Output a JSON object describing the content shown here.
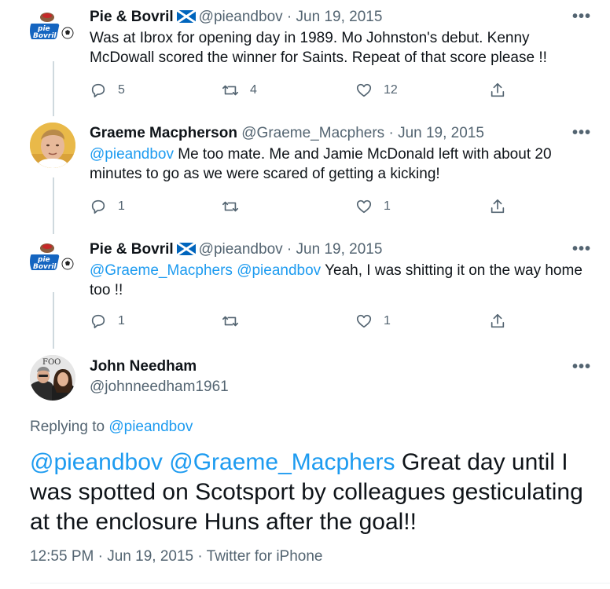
{
  "tweets": [
    {
      "name": "Pie & Bovril",
      "has_flag": true,
      "handle": "@pieandbov",
      "sep": "·",
      "date": "Jun 19, 2015",
      "text": "Was at Ibrox for opening day in 1989. Mo Johnston's debut. Kenny McDowall scored the winner for Saints. Repeat of that score please !!",
      "replies": "5",
      "retweets": "4",
      "likes": "12"
    },
    {
      "name": "Graeme Macpherson",
      "handle": "@Graeme_Macphers",
      "sep": "·",
      "date": "Jun 19, 2015",
      "mention": "@pieandbov",
      "text": " Me too mate. Me and Jamie McDonald left with about 20 minutes to go as we were scared of getting a kicking!",
      "replies": "1",
      "retweets": "",
      "likes": "1"
    },
    {
      "name": "Pie & Bovril",
      "has_flag": true,
      "handle": "@pieandbov",
      "sep": "·",
      "date": "Jun 19, 2015",
      "mention1": "@Graeme_Macphers",
      "mention2": "@pieandbov",
      "text": " Yeah, I was shitting it on the way home too !!",
      "replies": "1",
      "retweets": "",
      "likes": "1"
    }
  ],
  "main_tweet": {
    "name": "John Needham",
    "handle": "@johnneedham1961",
    "replying_prefix": "Replying to ",
    "replying_to": "@pieandbov",
    "mention1": "@pieandbov",
    "mention2": "@Graeme_Macphers",
    "text": " Great day until I was spotted on Scotsport by colleagues gesticulating at the enclosure Huns after the goal!!",
    "time": "12:55 PM",
    "sep": "·",
    "date": "Jun 19, 2015",
    "source": "Twitter for iPhone",
    "avatar_text": "FOO"
  },
  "logo": {
    "line1": "pie",
    "line2": "Bovril"
  },
  "more_label": "•••",
  "colors": {
    "accent": "#1d9bf0",
    "muted": "#536471",
    "text": "#0f1419",
    "thread_line": "#cfd9de",
    "flag_blue": "#0065bd"
  }
}
